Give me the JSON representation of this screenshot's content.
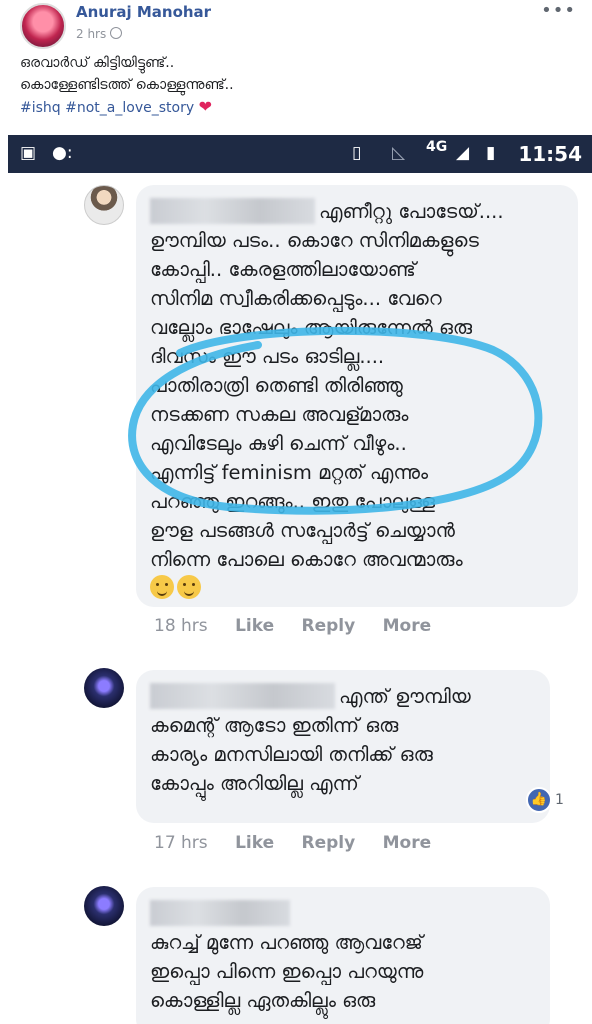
{
  "post": {
    "author": "Anuraj Manohar",
    "time": "2 hrs",
    "line1": "ഒരവാർഡ് കിട്ടിയിട്ടുണ്ട്..",
    "line2": "കൊള്ളേണ്ടിടത്ത് കൊള്ളുന്നുണ്ട്..",
    "hashtags": "#ishq #not_a_love_story",
    "more": "•••"
  },
  "statusbar": {
    "network": "4G",
    "time": "11:54"
  },
  "comments": [
    {
      "lines": [
        "എണീറ്റു പോടേയ്....",
        "ഊമ്പിയ പടം.. കൊറേ സിനിമകളുടെ",
        "കോപ്പി.. കേരളത്തിലായോണ്ട്",
        "സിനിമ സ്വീകരിക്കപ്പെടും... വേറെ",
        "വല്ലോം ഭാഷേലും ആയിരുന്നേൽ ഒരു",
        "ദിവസം ഈ പടം ഓടില്ല....",
        "പാതിരാത്രി തെണ്ടി തിരിഞ്ഞു",
        "നടക്കണ സകല അവള്മാരും",
        "എവിടേലും കുഴി ചെന്ന് വീഴും..",
        "എന്നിട്ട് feminism മറ്റത് എന്നും",
        "പറഞ്ഞു ഇറങ്ങും.. ഇതു പോലുള്ള",
        "ഊള പടങ്ങൾ സപ്പോർട്ട് ചെയ്യാൻ",
        "നിന്നെ പോലെ കൊറേ അവന്മാരും"
      ],
      "time": "18 hrs",
      "like": "Like",
      "reply": "Reply",
      "more": "More"
    },
    {
      "lines": [
        "എന്ത് ഊമ്പിയ",
        "കമെന്റ് ആടോ ഇതിന്ന് ഒരു",
        "കാര്യം മനസിലായി തനിക്ക് ഒരു",
        "കോപ്പും അറിയില്ല എന്ന്"
      ],
      "likes": "1",
      "time": "17 hrs",
      "like": "Like",
      "reply": "Reply",
      "more": "More"
    },
    {
      "lines": [
        "കുറച്ച് മുന്നേ പറഞ്ഞു ആവറേജ്",
        "ഇപ്പൊ പിന്നെ ഇപ്പൊ പറയുന്നു",
        "കൊള്ളില്ല ഏതകില്ലും ഒരു"
      ]
    }
  ],
  "colors": {
    "link": "#365899",
    "statusbar": "#1e2a44",
    "bubble": "#f0f2f5",
    "annotation": "#3fb6e8"
  }
}
